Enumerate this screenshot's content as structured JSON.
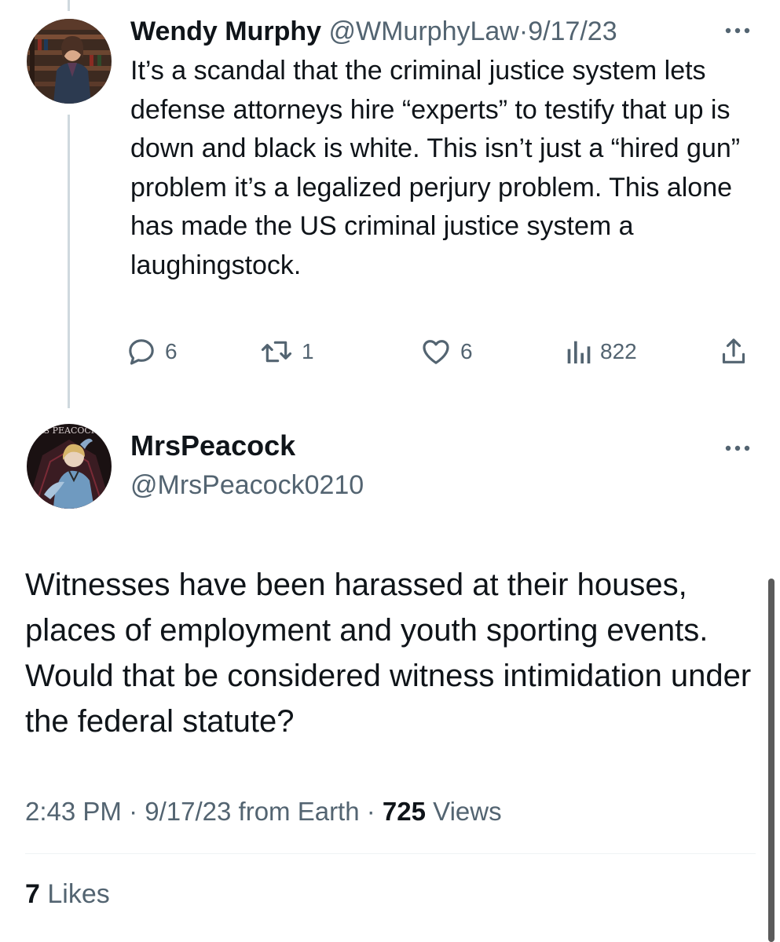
{
  "parent_tweet": {
    "display_name": "Wendy Murphy",
    "handle": "@WMurphyLaw",
    "separator": "·",
    "date": "9/17/23",
    "text": "It’s a scandal that the criminal justice system lets defense attorneys hire “experts” to testify that up is down and black is white. This isn’t just a “hired gun” problem it’s a legalized perjury problem. This alone has made the US criminal justice system a laughingstock.",
    "actions": {
      "replies": "6",
      "retweets": "1",
      "likes": "6",
      "views": "822"
    }
  },
  "main_tweet": {
    "display_name": "MrsPeacock",
    "handle": "@MrsPeacock0210",
    "avatar_text": "MRS PEACOCK",
    "text": "Witnesses have been harassed at their houses, places of employment and youth sporting events. Would that be considered witness intimidation under the federal statute?",
    "time": "2:43 PM",
    "separator": "·",
    "date": "9/17/23",
    "source": "from Earth",
    "views_count": "725",
    "views_label": "Views",
    "likes_count": "7",
    "likes_label": "Likes"
  },
  "icons": {
    "more": "more-horizontal-icon",
    "reply": "reply-icon",
    "retweet": "retweet-icon",
    "like": "heart-icon",
    "views": "analytics-icon",
    "share": "share-icon"
  },
  "colors": {
    "text_primary": "#0f1419",
    "text_secondary": "#536471",
    "thread_line": "#cfd9de",
    "divider": "#eff3f4"
  }
}
